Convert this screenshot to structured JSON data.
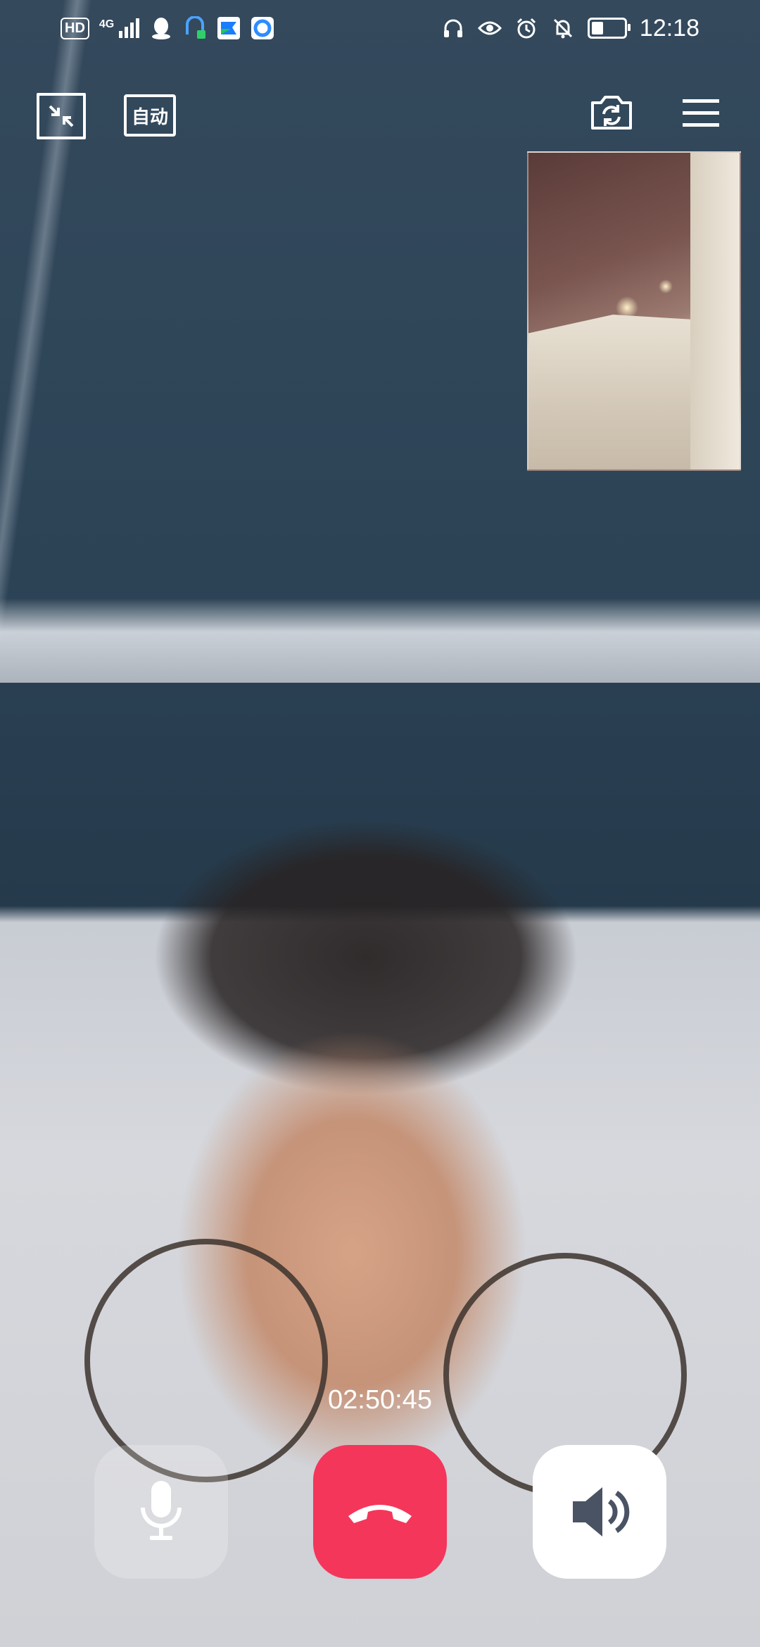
{
  "status_bar": {
    "time": "12:18",
    "hd_label": "HD",
    "network_label": "4G",
    "left_icons": [
      "hd-icon",
      "4g-signal-icon",
      "qq-icon",
      "vpn-icon",
      "flag-app-icon",
      "browser-icon"
    ],
    "right_icons": [
      "headphones-icon",
      "eye-icon",
      "alarm-icon",
      "mute-bell-icon",
      "battery-icon"
    ]
  },
  "top_controls": {
    "auto_label": "自动"
  },
  "call": {
    "duration": "02:50:45"
  },
  "colors": {
    "hangup": "#f4365b",
    "speaker_bg": "#ffffff",
    "speaker_icon": "#4a5364"
  }
}
